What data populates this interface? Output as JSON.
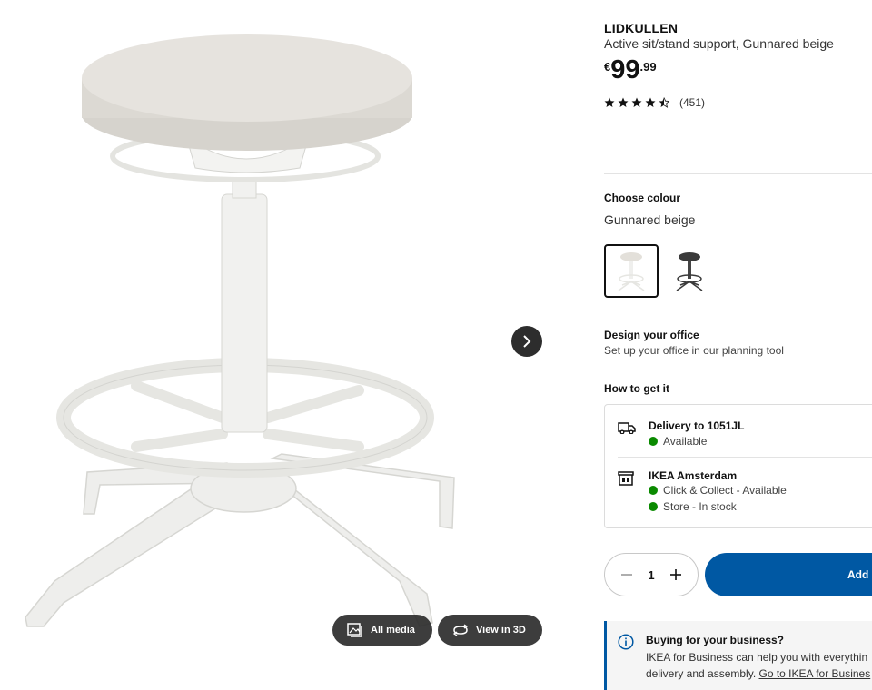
{
  "product": {
    "name": "LIDKULLEN",
    "description": "Active sit/stand support, Gunnared beige",
    "price": {
      "currency": "€",
      "integer": "99",
      "decimals": ".99"
    },
    "rating": {
      "stars": 4.5,
      "count": "(451)"
    }
  },
  "media": {
    "next_icon": "chevron-right-icon",
    "all_media_label": "All media",
    "view_3d_label": "View in 3D"
  },
  "colour": {
    "heading": "Choose colour",
    "selected": "Gunnared beige",
    "options": [
      "beige-stool-thumbnail",
      "dark-stool-thumbnail"
    ]
  },
  "design": {
    "title": "Design your office",
    "subtitle": "Set up your office in our planning tool"
  },
  "availability": {
    "heading": "How to get it",
    "delivery": {
      "title": "Delivery to 1051JL",
      "status": "Available"
    },
    "store": {
      "title": "IKEA Amsterdam",
      "click_collect": "Click & Collect - Available",
      "in_store": "Store - In stock"
    },
    "status_color": "#0a8a00"
  },
  "purchase": {
    "quantity": "1",
    "add_label": "Add",
    "accent": "#0058a3"
  },
  "business": {
    "title": "Buying for your business?",
    "line1": "IKEA for Business can help you with everythin",
    "line2_prefix": "delivery and assembly. ",
    "link": "Go to IKEA for Busines"
  }
}
